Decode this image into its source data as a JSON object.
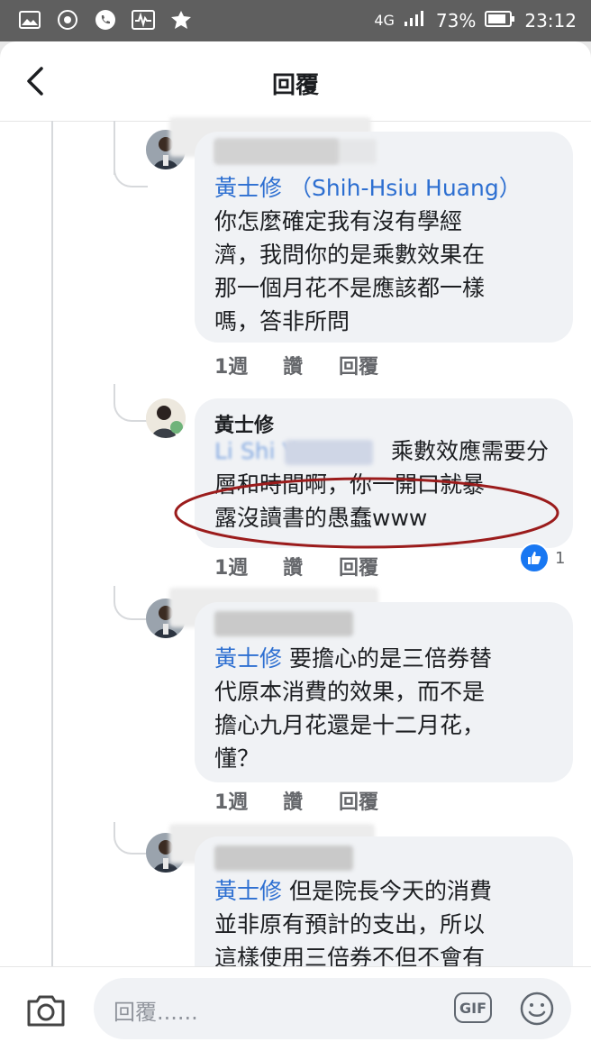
{
  "status_bar": {
    "network": "4G",
    "battery": "73%",
    "time": "23:12"
  },
  "header": {
    "title": "回覆"
  },
  "comments": [
    {
      "mention": "黃士修 （Shih-Hsiu Huang）",
      "text": "你怎麼確定我有沒有學經\n濟，我問你的是乘數效果在\n那一個月花不是應該都一樣\n嗎，答非所問",
      "time": "1週",
      "like_label": "讚",
      "reply_label": "回覆"
    },
    {
      "author": "黃士修",
      "mention_partial": "Li Shi Y",
      "text_line1": "乘數效應需要分",
      "text_rest": "層和時間啊，你一開口就暴\n露沒讀書的愚蠢www",
      "time": "1週",
      "like_label": "讚",
      "reply_label": "回覆",
      "reaction_count": "1"
    },
    {
      "mention": "黃士修",
      "text_first": " 要擔心的是三倍券替",
      "text": "代原本消費的效果，而不是\n擔心九月花還是十二月花，\n懂？",
      "time": "1週",
      "like_label": "讚",
      "reply_label": "回覆"
    },
    {
      "mention": "黃士修",
      "text_first": " 但是院長今天的消費",
      "text": "並非原有預計的支出，所以\n這樣使用三倍券不但不會有"
    }
  ],
  "composer": {
    "placeholder": "回覆......",
    "gif_label": "GIF"
  },
  "colors": {
    "mention": "#2d6fd1",
    "bubble": "#f0f2f5",
    "highlight_ellipse": "#9b1c1c"
  }
}
